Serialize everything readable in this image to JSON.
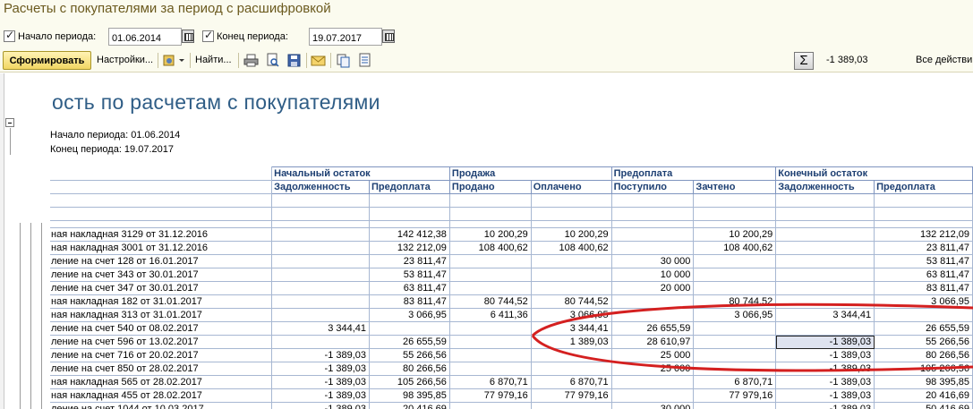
{
  "window": {
    "title": "Расчеты с покупателями за период с расшифровкой"
  },
  "period": {
    "start_label": "Начало периода:",
    "start_value": "01.06.2014",
    "end_label": "Конец периода:",
    "end_value": "19.07.2017"
  },
  "toolbar": {
    "generate": "Сформировать",
    "settings": "Настройки...",
    "find": "Найти...",
    "sum_value": "-1 389,03",
    "all_actions": "Все действи"
  },
  "report": {
    "title": "ость по расчетам с покупателями",
    "period_start": "Начало периода: 01.06.2014",
    "period_end": "Конец периода: 19.07.2017",
    "groups": [
      "Начальный остаток",
      "Продажа",
      "Предоплата",
      "Конечный остаток"
    ],
    "subheaders": [
      "Задолженность",
      "Предоплата",
      "Продано",
      "Оплачено",
      "Поступило",
      "Зачтено",
      "Задолженность",
      "Предоплата"
    ],
    "rows": [
      [
        "ная накладная 3129 от 31.12.2016",
        "",
        "142 412,38",
        "10 200,29",
        "10 200,29",
        "",
        "10 200,29",
        "",
        "132 212,09"
      ],
      [
        "ная накладная 3001 от 31.12.2016",
        "",
        "132 212,09",
        "108 400,62",
        "108 400,62",
        "",
        "108 400,62",
        "",
        "23 811,47"
      ],
      [
        "ление на счет 128 от 16.01.2017",
        "",
        "23 811,47",
        "",
        "",
        "30 000",
        "",
        "",
        "53 811,47"
      ],
      [
        "ление на счет 343 от 30.01.2017",
        "",
        "53 811,47",
        "",
        "",
        "10 000",
        "",
        "",
        "63 811,47"
      ],
      [
        "ление на счет 347 от 30.01.2017",
        "",
        "63 811,47",
        "",
        "",
        "20 000",
        "",
        "",
        "83 811,47"
      ],
      [
        "ная накладная 182 от 31.01.2017",
        "",
        "83 811,47",
        "80 744,52",
        "80 744,52",
        "",
        "80 744,52",
        "",
        "3 066,95"
      ],
      [
        "ная накладная 313 от 31.01.2017",
        "",
        "3 066,95",
        "6 411,36",
        "3 066,95",
        "",
        "3 066,95",
        "3 344,41",
        ""
      ],
      [
        "ление на счет 540 от 08.02.2017",
        "3 344,41",
        "",
        "",
        "3 344,41",
        "26 655,59",
        "",
        "",
        "26 655,59"
      ],
      [
        "ление на счет 596 от 13.02.2017",
        "",
        "26 655,59",
        "",
        "1 389,03",
        "28 610,97",
        "",
        "-1 389,03",
        "55 266,56"
      ],
      [
        "ление на счет 716 от 20.02.2017",
        "-1 389,03",
        "55 266,56",
        "",
        "",
        "25 000",
        "",
        "-1 389,03",
        "80 266,56"
      ],
      [
        "ление на счет 850 от 28.02.2017",
        "-1 389,03",
        "80 266,56",
        "",
        "",
        "25 000",
        "",
        "-1 389,03",
        "105 266,56"
      ],
      [
        "ная накладная 565 от 28.02.2017",
        "-1 389,03",
        "105 266,56",
        "6 870,71",
        "6 870,71",
        "",
        "6 870,71",
        "-1 389,03",
        "98 395,85"
      ],
      [
        "ная накладная 455 от 28.02.2017",
        "-1 389,03",
        "98 395,85",
        "77 979,16",
        "77 979,16",
        "",
        "77 979,16",
        "-1 389,03",
        "20 416,69"
      ],
      [
        "ление на счет 1044 от 10.03.2017",
        "-1 389,03",
        "20 416,69",
        "",
        "",
        "30 000",
        "",
        "-1 389,03",
        "50 416,69"
      ]
    ]
  },
  "colors": {
    "title_text": "#6b5a1e",
    "report_title": "#2f5d86",
    "grid_header": "#1d3f72",
    "annotation": "#d42020"
  }
}
